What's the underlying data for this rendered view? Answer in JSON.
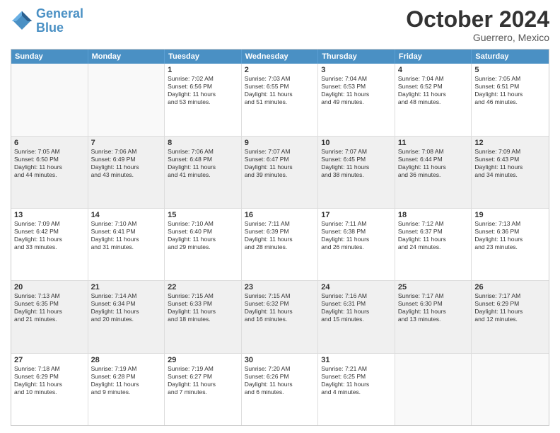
{
  "header": {
    "logo_line1": "General",
    "logo_line2": "Blue",
    "title": "October 2024",
    "subtitle": "Guerrero, Mexico"
  },
  "days": [
    "Sunday",
    "Monday",
    "Tuesday",
    "Wednesday",
    "Thursday",
    "Friday",
    "Saturday"
  ],
  "weeks": [
    [
      {
        "day": "",
        "lines": []
      },
      {
        "day": "",
        "lines": []
      },
      {
        "day": "1",
        "lines": [
          "Sunrise: 7:02 AM",
          "Sunset: 6:56 PM",
          "Daylight: 11 hours",
          "and 53 minutes."
        ]
      },
      {
        "day": "2",
        "lines": [
          "Sunrise: 7:03 AM",
          "Sunset: 6:55 PM",
          "Daylight: 11 hours",
          "and 51 minutes."
        ]
      },
      {
        "day": "3",
        "lines": [
          "Sunrise: 7:04 AM",
          "Sunset: 6:53 PM",
          "Daylight: 11 hours",
          "and 49 minutes."
        ]
      },
      {
        "day": "4",
        "lines": [
          "Sunrise: 7:04 AM",
          "Sunset: 6:52 PM",
          "Daylight: 11 hours",
          "and 48 minutes."
        ]
      },
      {
        "day": "5",
        "lines": [
          "Sunrise: 7:05 AM",
          "Sunset: 6:51 PM",
          "Daylight: 11 hours",
          "and 46 minutes."
        ]
      }
    ],
    [
      {
        "day": "6",
        "lines": [
          "Sunrise: 7:05 AM",
          "Sunset: 6:50 PM",
          "Daylight: 11 hours",
          "and 44 minutes."
        ]
      },
      {
        "day": "7",
        "lines": [
          "Sunrise: 7:06 AM",
          "Sunset: 6:49 PM",
          "Daylight: 11 hours",
          "and 43 minutes."
        ]
      },
      {
        "day": "8",
        "lines": [
          "Sunrise: 7:06 AM",
          "Sunset: 6:48 PM",
          "Daylight: 11 hours",
          "and 41 minutes."
        ]
      },
      {
        "day": "9",
        "lines": [
          "Sunrise: 7:07 AM",
          "Sunset: 6:47 PM",
          "Daylight: 11 hours",
          "and 39 minutes."
        ]
      },
      {
        "day": "10",
        "lines": [
          "Sunrise: 7:07 AM",
          "Sunset: 6:45 PM",
          "Daylight: 11 hours",
          "and 38 minutes."
        ]
      },
      {
        "day": "11",
        "lines": [
          "Sunrise: 7:08 AM",
          "Sunset: 6:44 PM",
          "Daylight: 11 hours",
          "and 36 minutes."
        ]
      },
      {
        "day": "12",
        "lines": [
          "Sunrise: 7:09 AM",
          "Sunset: 6:43 PM",
          "Daylight: 11 hours",
          "and 34 minutes."
        ]
      }
    ],
    [
      {
        "day": "13",
        "lines": [
          "Sunrise: 7:09 AM",
          "Sunset: 6:42 PM",
          "Daylight: 11 hours",
          "and 33 minutes."
        ]
      },
      {
        "day": "14",
        "lines": [
          "Sunrise: 7:10 AM",
          "Sunset: 6:41 PM",
          "Daylight: 11 hours",
          "and 31 minutes."
        ]
      },
      {
        "day": "15",
        "lines": [
          "Sunrise: 7:10 AM",
          "Sunset: 6:40 PM",
          "Daylight: 11 hours",
          "and 29 minutes."
        ]
      },
      {
        "day": "16",
        "lines": [
          "Sunrise: 7:11 AM",
          "Sunset: 6:39 PM",
          "Daylight: 11 hours",
          "and 28 minutes."
        ]
      },
      {
        "day": "17",
        "lines": [
          "Sunrise: 7:11 AM",
          "Sunset: 6:38 PM",
          "Daylight: 11 hours",
          "and 26 minutes."
        ]
      },
      {
        "day": "18",
        "lines": [
          "Sunrise: 7:12 AM",
          "Sunset: 6:37 PM",
          "Daylight: 11 hours",
          "and 24 minutes."
        ]
      },
      {
        "day": "19",
        "lines": [
          "Sunrise: 7:13 AM",
          "Sunset: 6:36 PM",
          "Daylight: 11 hours",
          "and 23 minutes."
        ]
      }
    ],
    [
      {
        "day": "20",
        "lines": [
          "Sunrise: 7:13 AM",
          "Sunset: 6:35 PM",
          "Daylight: 11 hours",
          "and 21 minutes."
        ]
      },
      {
        "day": "21",
        "lines": [
          "Sunrise: 7:14 AM",
          "Sunset: 6:34 PM",
          "Daylight: 11 hours",
          "and 20 minutes."
        ]
      },
      {
        "day": "22",
        "lines": [
          "Sunrise: 7:15 AM",
          "Sunset: 6:33 PM",
          "Daylight: 11 hours",
          "and 18 minutes."
        ]
      },
      {
        "day": "23",
        "lines": [
          "Sunrise: 7:15 AM",
          "Sunset: 6:32 PM",
          "Daylight: 11 hours",
          "and 16 minutes."
        ]
      },
      {
        "day": "24",
        "lines": [
          "Sunrise: 7:16 AM",
          "Sunset: 6:31 PM",
          "Daylight: 11 hours",
          "and 15 minutes."
        ]
      },
      {
        "day": "25",
        "lines": [
          "Sunrise: 7:17 AM",
          "Sunset: 6:30 PM",
          "Daylight: 11 hours",
          "and 13 minutes."
        ]
      },
      {
        "day": "26",
        "lines": [
          "Sunrise: 7:17 AM",
          "Sunset: 6:29 PM",
          "Daylight: 11 hours",
          "and 12 minutes."
        ]
      }
    ],
    [
      {
        "day": "27",
        "lines": [
          "Sunrise: 7:18 AM",
          "Sunset: 6:29 PM",
          "Daylight: 11 hours",
          "and 10 minutes."
        ]
      },
      {
        "day": "28",
        "lines": [
          "Sunrise: 7:19 AM",
          "Sunset: 6:28 PM",
          "Daylight: 11 hours",
          "and 9 minutes."
        ]
      },
      {
        "day": "29",
        "lines": [
          "Sunrise: 7:19 AM",
          "Sunset: 6:27 PM",
          "Daylight: 11 hours",
          "and 7 minutes."
        ]
      },
      {
        "day": "30",
        "lines": [
          "Sunrise: 7:20 AM",
          "Sunset: 6:26 PM",
          "Daylight: 11 hours",
          "and 6 minutes."
        ]
      },
      {
        "day": "31",
        "lines": [
          "Sunrise: 7:21 AM",
          "Sunset: 6:25 PM",
          "Daylight: 11 hours",
          "and 4 minutes."
        ]
      },
      {
        "day": "",
        "lines": []
      },
      {
        "day": "",
        "lines": []
      }
    ]
  ]
}
